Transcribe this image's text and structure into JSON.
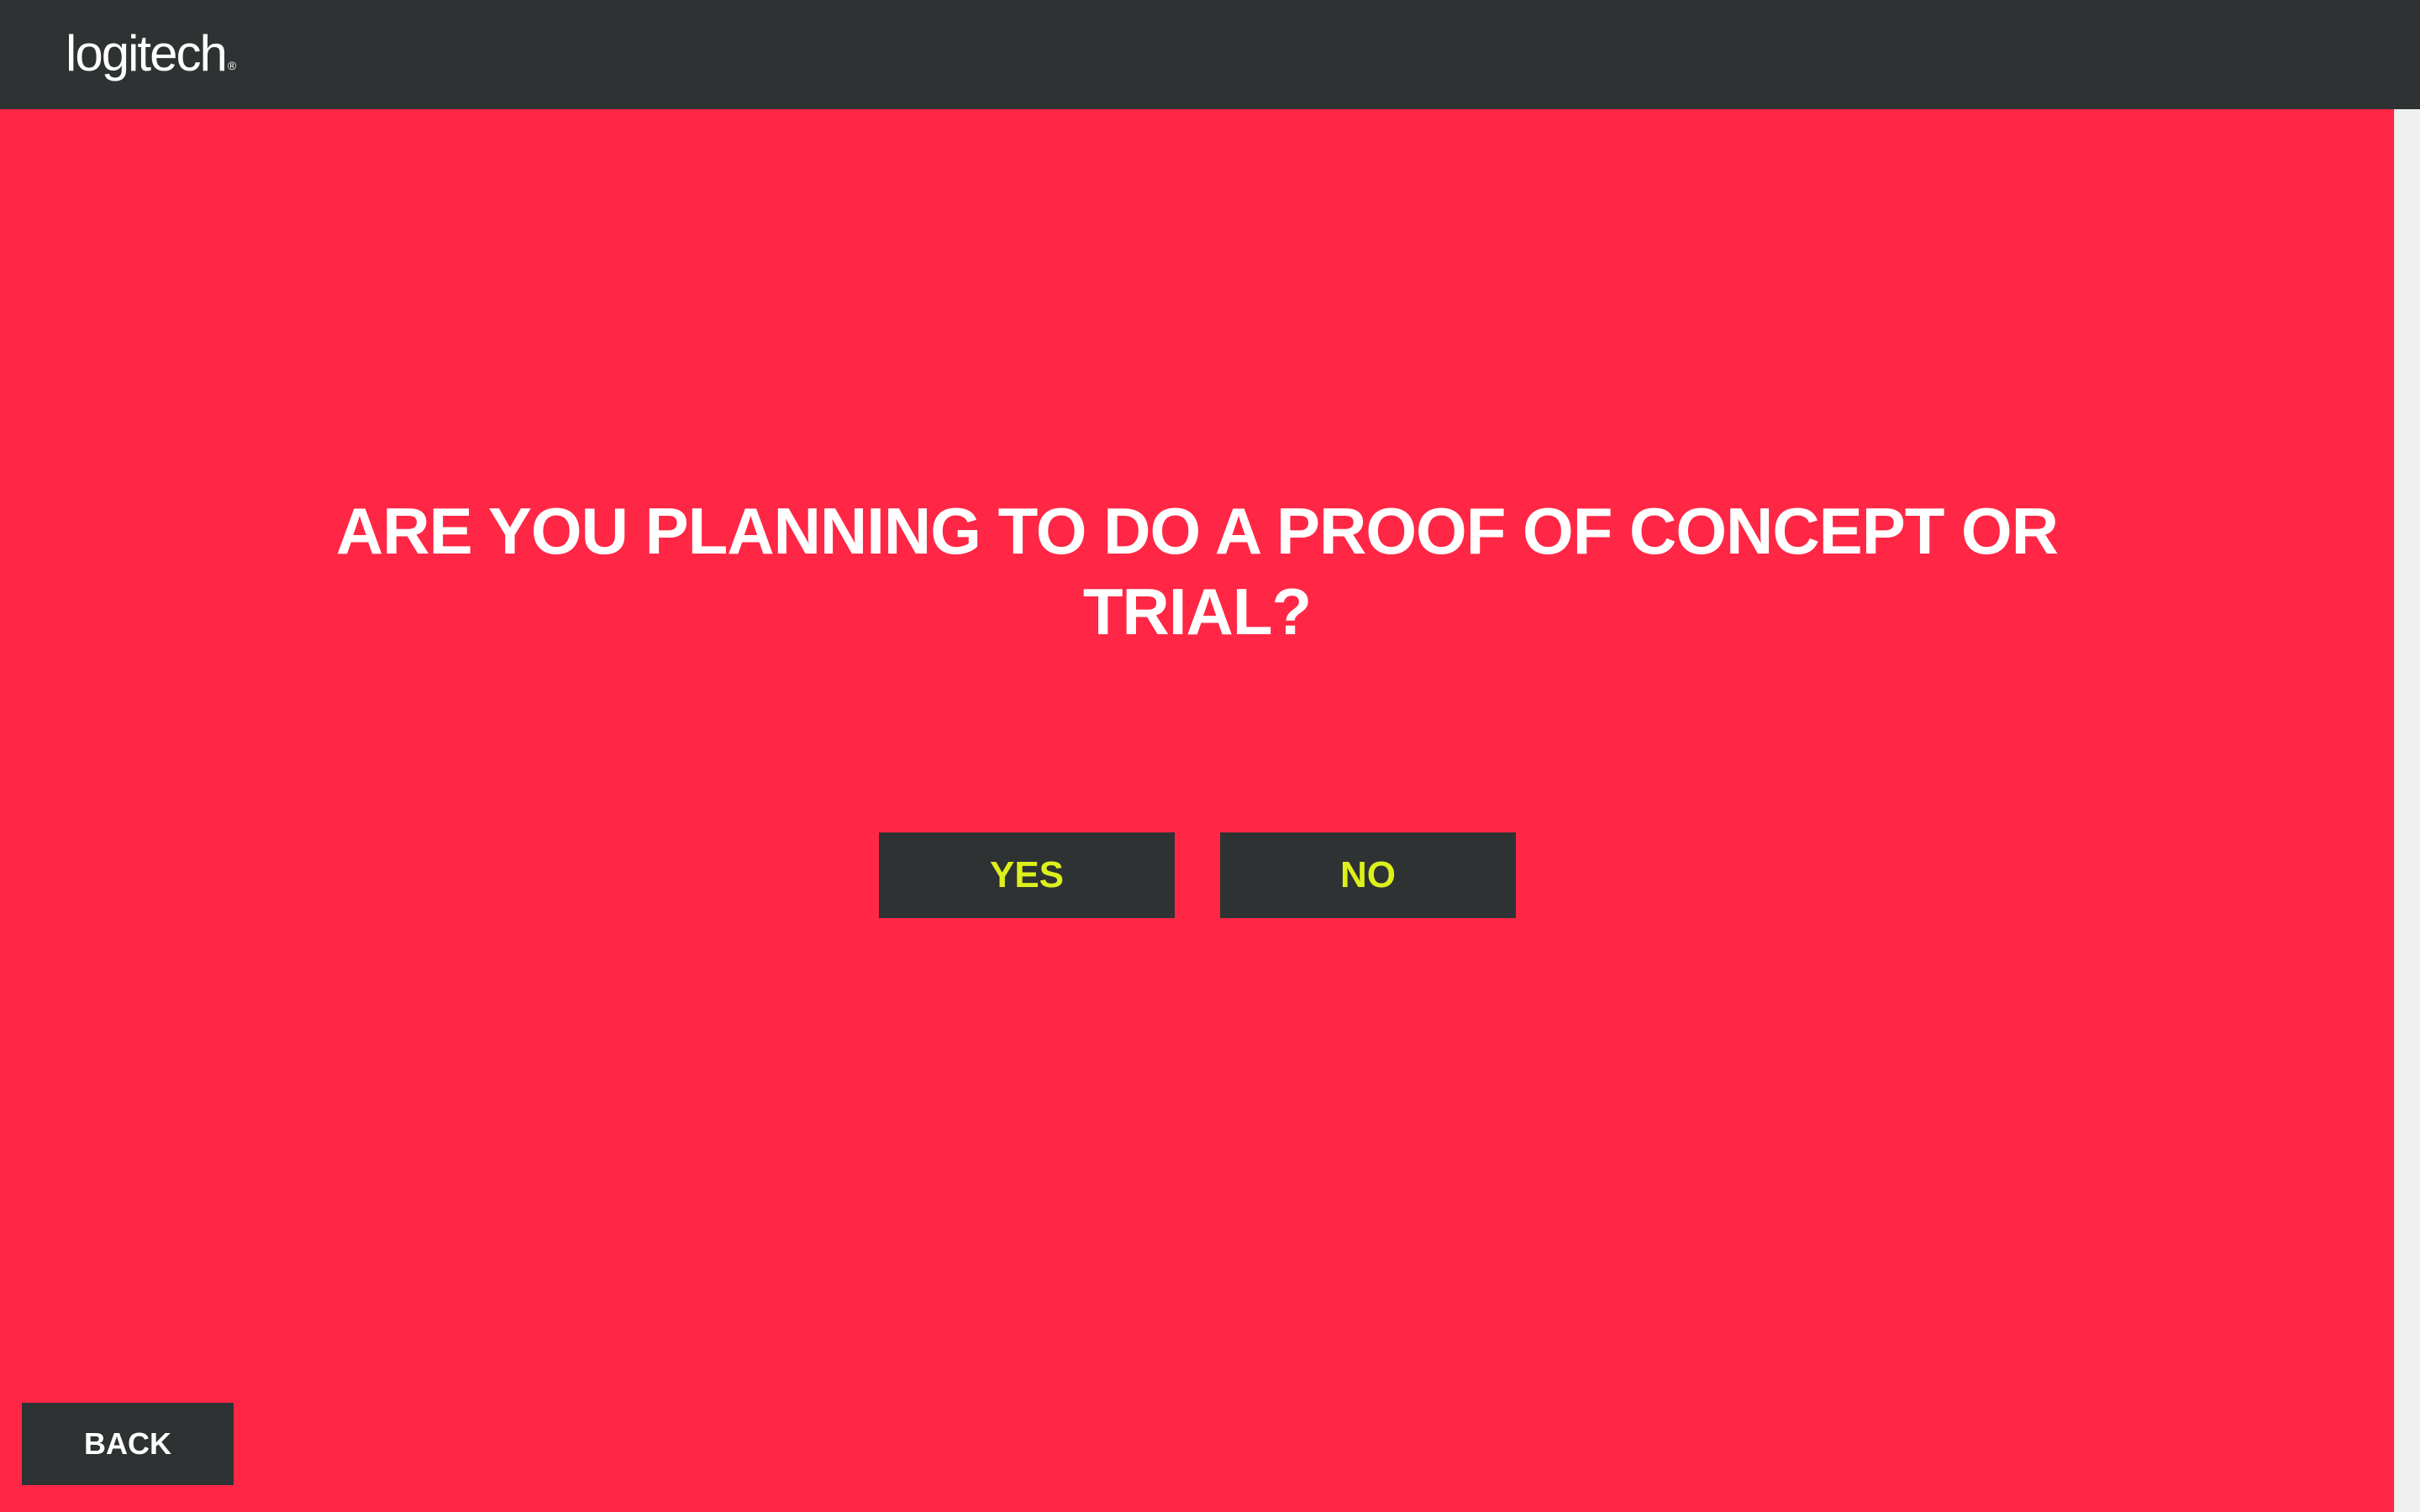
{
  "header": {
    "logo_text": "logitech",
    "logo_mark": "®",
    "background_color": "#2f3233"
  },
  "main": {
    "background_color": "#ff2745",
    "question": "ARE YOU PLANNING TO DO A PROOF OF CONCEPT OR TRIAL?",
    "answers": {
      "yes_label": "YES",
      "no_label": "NO",
      "label_color": "#ddf01b"
    }
  },
  "footer": {
    "back_label": "BACK"
  }
}
